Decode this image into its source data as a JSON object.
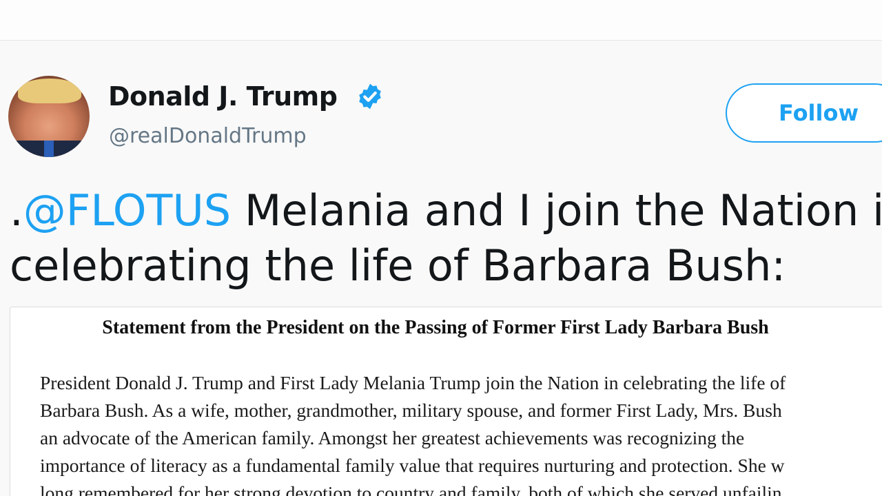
{
  "tweet": {
    "author": {
      "display_name": "Donald J. Trump",
      "handle": "@realDonaldTrump",
      "verified_icon": "verified-badge-icon"
    },
    "follow_label": "Follow",
    "text": {
      "prefix": ".",
      "mention": "@FLOTUS",
      "line1_rest": " Melania and I join the Nation in",
      "line2": "celebrating the life of Barbara Bush:"
    },
    "attachment": {
      "title": "Statement from the President on the Passing of Former First Lady Barbara Bush",
      "lines": [
        "President Donald J. Trump and First Lady Melania Trump join the Nation in celebrating the life of",
        "Barbara Bush. As a wife, mother, grandmother, military spouse, and former First Lady, Mrs. Bush",
        "an advocate of the American family. Amongst her greatest achievements was recognizing the",
        "importance of literacy as a fundamental family value that requires nurturing and protection. She w",
        "long remembered for her strong devotion to country and family, both of which she served unfailin"
      ]
    }
  },
  "colors": {
    "accent": "#1da1f2",
    "text": "#14171a",
    "muted": "#657786"
  }
}
